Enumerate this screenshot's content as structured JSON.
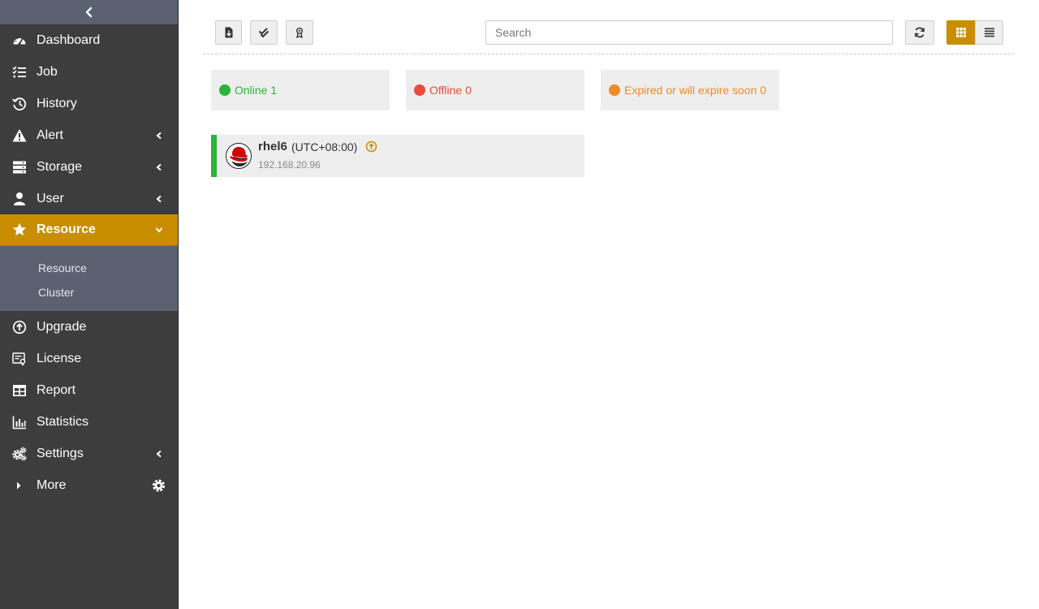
{
  "sidebar": {
    "items": [
      {
        "label": "Dashboard",
        "icon": "dashboard-icon",
        "has_caret": false
      },
      {
        "label": "Job",
        "icon": "job-list-icon",
        "has_caret": false
      },
      {
        "label": "History",
        "icon": "history-icon",
        "has_caret": false
      },
      {
        "label": "Alert",
        "icon": "alert-icon",
        "has_caret": true
      },
      {
        "label": "Storage",
        "icon": "storage-icon",
        "has_caret": true
      },
      {
        "label": "User",
        "icon": "user-icon",
        "has_caret": true
      },
      {
        "label": "Resource",
        "icon": "star-icon",
        "has_caret": true,
        "active": true
      }
    ],
    "submenu": [
      "Resource",
      "Cluster"
    ],
    "items_bottom": [
      {
        "label": "Upgrade",
        "icon": "upgrade-icon"
      },
      {
        "label": "License",
        "icon": "license-icon"
      },
      {
        "label": "Report",
        "icon": "report-icon"
      },
      {
        "label": "Statistics",
        "icon": "statistics-icon"
      },
      {
        "label": "Settings",
        "icon": "settings-icon"
      },
      {
        "label": "More",
        "icon": "caret-right-icon"
      }
    ]
  },
  "toolbar": {
    "search_placeholder": "Search",
    "buttons": [
      "import-icon",
      "check-all-icon",
      "license-badge-icon",
      "refresh-icon",
      "grid-view-icon",
      "list-view-icon"
    ]
  },
  "status": {
    "online": "Online 1",
    "offline": "Offline 0",
    "expired": "Expired or will expire soon 0"
  },
  "colors": {
    "accent": "#c88e00",
    "online": "#2bb43a",
    "offline": "#e74c3c",
    "expired": "#f08a24"
  },
  "resources": [
    {
      "name": "rhel6",
      "timezone": "(UTC+08:00)",
      "ip": "192.168.20.96",
      "status": "online"
    }
  ]
}
